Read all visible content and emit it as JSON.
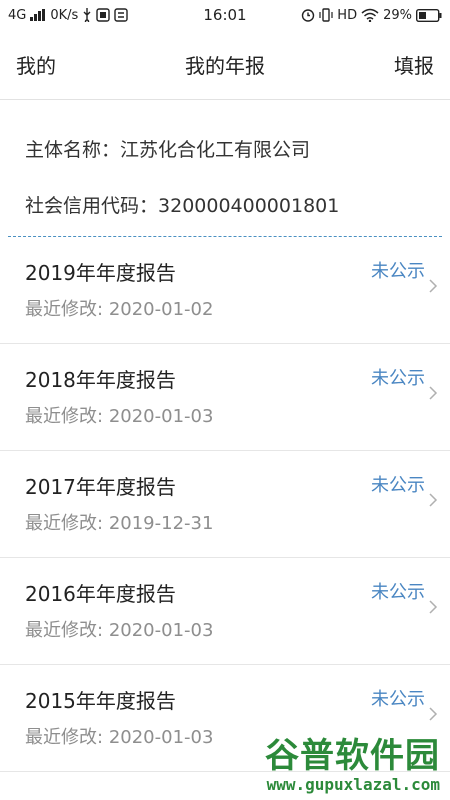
{
  "status_bar": {
    "network": "4G",
    "speed": "0K/s",
    "time": "16:01",
    "hd_label": "HD",
    "battery": "29%",
    "icons": [
      "signal-icon",
      "usb-icon",
      "sim-icon",
      "sync-icon",
      "alarm-icon",
      "vibrate-icon",
      "wifi-icon",
      "battery-icon"
    ]
  },
  "nav": {
    "left": "我的",
    "title": "我的年报",
    "right": "填报"
  },
  "entity": {
    "name_label": "主体名称：",
    "name_value": "江苏化合化工有限公司",
    "code_label": "社会信用代码：",
    "code_value": "320000400001801"
  },
  "reports": [
    {
      "title": "2019年年度报告",
      "status": "未公示",
      "modified_label": "最近修改:",
      "modified_date": "2020-01-02"
    },
    {
      "title": "2018年年度报告",
      "status": "未公示",
      "modified_label": "最近修改:",
      "modified_date": "2020-01-03"
    },
    {
      "title": "2017年年度报告",
      "status": "未公示",
      "modified_label": "最近修改:",
      "modified_date": "2019-12-31"
    },
    {
      "title": "2016年年度报告",
      "status": "未公示",
      "modified_label": "最近修改:",
      "modified_date": "2020-01-03"
    },
    {
      "title": "2015年年度报告",
      "status": "未公示",
      "modified_label": "最近修改:",
      "modified_date": "2020-01-03"
    }
  ],
  "watermark": {
    "text": "谷普软件园",
    "url": "www.gupuxlazal.com"
  },
  "colors": {
    "status_blue": "#4a86c2",
    "divider_blue": "#4a90c2",
    "muted_gray": "#8e8e8e",
    "watermark_green": "#2c8a3a"
  }
}
